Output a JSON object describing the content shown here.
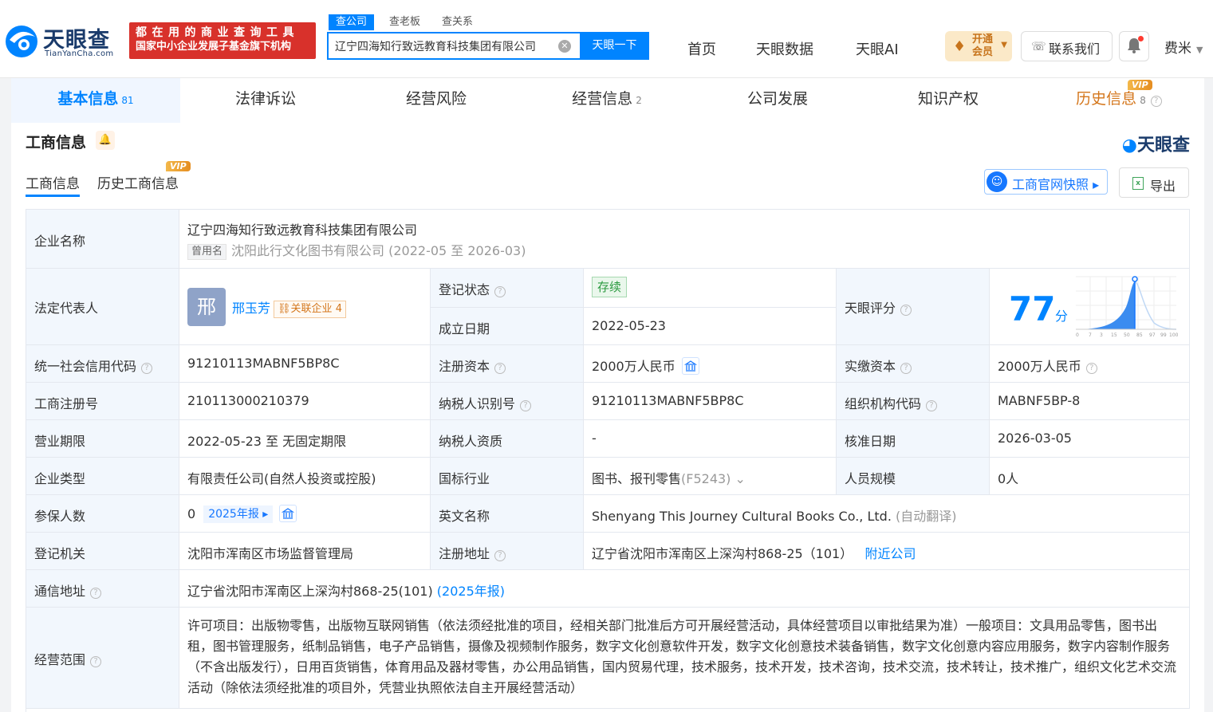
{
  "header": {
    "logo_text": "天眼查",
    "logo_sub": "TianYanCha.com",
    "promo_line1": "都在用的商业查询工具",
    "promo_line2": "国家中小企业发展子基金旗下机构",
    "search_tabs": [
      "查公司",
      "查老板",
      "查关系"
    ],
    "search_value": "辽宁四海知行致远教育科技集团有限公司",
    "search_button": "天眼一下",
    "nav": [
      "首页",
      "天眼数据",
      "天眼AI"
    ],
    "vip_label_1": "开通",
    "vip_label_2": "会员",
    "contact": "联系我们",
    "user": "费米"
  },
  "tabs": [
    {
      "label": "基本信息",
      "count": "81"
    },
    {
      "label": "法律诉讼",
      "count": ""
    },
    {
      "label": "经营风险",
      "count": ""
    },
    {
      "label": "经营信息",
      "count": "2"
    },
    {
      "label": "公司发展",
      "count": ""
    },
    {
      "label": "知识产权",
      "count": ""
    },
    {
      "label": "历史信息",
      "count": "8"
    }
  ],
  "vip_tag": "VIP",
  "section": {
    "title": "工商信息",
    "brand": "天眼查",
    "subtabs": [
      "工商信息",
      "历史工商信息"
    ],
    "snapshot_button": "工商官网快照",
    "export_button": "导出"
  },
  "info": {
    "company_name_label": "企业名称",
    "company_name": "辽宁四海知行致远教育科技集团有限公司",
    "used_name_badge": "曾用名",
    "used_name": "沈阳此行文化图书有限公司 (2022-05 至 2026-03)",
    "legal_rep_label": "法定代表人",
    "legal_rep_avatar": "邢",
    "legal_rep": "邢玉芳",
    "related_label": "关联企业",
    "related_count": "4",
    "reg_status_label": "登记状态",
    "reg_status": "存续",
    "found_date_label": "成立日期",
    "found_date": "2022-05-23",
    "score_label": "天眼评分",
    "score": "77",
    "score_unit": "分",
    "credit_code_label": "统一社会信用代码",
    "credit_code": "91210113MABNF5BP8C",
    "reg_capital_label": "注册资本",
    "reg_capital": "2000万人民币",
    "paid_capital_label": "实缴资本",
    "paid_capital": "2000万人民币",
    "reg_no_label": "工商注册号",
    "reg_no": "210113000210379",
    "taxpayer_id_label": "纳税人识别号",
    "taxpayer_id": "91210113MABNF5BP8C",
    "org_code_label": "组织机构代码",
    "org_code": "MABNF5BP-8",
    "term_label": "营业期限",
    "term": "2022-05-23 至 无固定期限",
    "tax_qual_label": "纳税人资质",
    "tax_qual": "-",
    "approve_date_label": "核准日期",
    "approve_date": "2026-03-05",
    "type_label": "企业类型",
    "type": "有限责任公司(自然人投资或控股)",
    "industry_label": "国标行业",
    "industry": "图书、报刊零售",
    "industry_code": "(F5243)",
    "staff_label": "人员规模",
    "staff": "0人",
    "insured_label": "参保人数",
    "insured": "0",
    "insured_year": "2025年报",
    "english_label": "英文名称",
    "english": "Shenyang This Journey Cultural Books Co., Ltd.",
    "english_note": "(自动翻译)",
    "authority_label": "登记机关",
    "authority": "沈阳市浑南区市场监督管理局",
    "address_label": "注册地址",
    "address": "辽宁省沈阳市浑南区上深沟村868-25（101）",
    "nearby": "附近公司",
    "mail_label": "通信地址",
    "mail": "辽宁省沈阳市浑南区上深沟村868-25(101)",
    "mail_year": "(2025年报)",
    "scope_label": "经营范围",
    "scope": "许可项目：出版物零售，出版物互联网销售（依法须经批准的项目，经相关部门批准后方可开展经营活动，具体经营项目以审批结果为准）一般项目：文具用品零售，图书出租，图书管理服务，纸制品销售，电子产品销售，摄像及视频制作服务，数字文化创意软件开发，数字文化创意技术装备销售，数字文化创意内容应用服务，数字内容制作服务（不含出版发行），日用百货销售，体育用品及器材零售，办公用品销售，国内贸易代理，技术服务，技术开发，技术咨询，技术交流，技术转让，技术推广，组织文化艺术交流活动（除依法须经批准的项目外，凭营业执照依法自主开展经营活动）"
  },
  "score_chart_ticks": [
    "0",
    "7",
    "3",
    "15",
    "50",
    "85",
    "97",
    "99",
    "100"
  ],
  "colors": {
    "accent": "#0084ff",
    "promo": "#d8312b",
    "vip": "#d4761b"
  }
}
